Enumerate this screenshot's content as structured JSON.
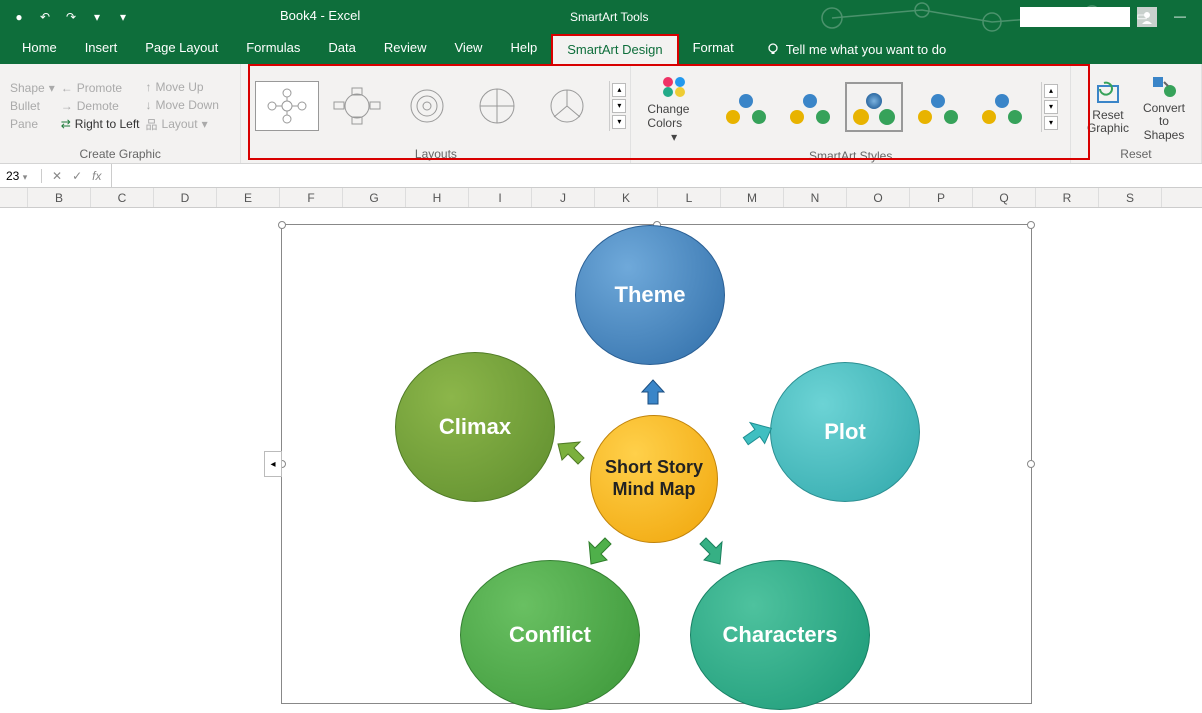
{
  "app": {
    "title": "Book4 - Excel",
    "context_tab": "SmartArt Tools"
  },
  "tabs": {
    "home": "Home",
    "insert": "Insert",
    "page_layout": "Page Layout",
    "formulas": "Formulas",
    "data": "Data",
    "review": "Review",
    "view": "View",
    "help": "Help",
    "smartart_design": "SmartArt Design",
    "format": "Format",
    "tell_me": "Tell me what you want to do"
  },
  "ribbon": {
    "create_graphic": {
      "label": "Create Graphic",
      "shape": "Shape",
      "bullet": "Bullet",
      "pane": "Pane",
      "promote": "Promote",
      "demote": "Demote",
      "rtl": "Right to Left",
      "move_up": "Move Up",
      "move_down": "Move Down",
      "layout": "Layout"
    },
    "layouts": {
      "label": "Layouts"
    },
    "change_colors": "Change Colors",
    "styles": {
      "label": "SmartArt Styles"
    },
    "reset": {
      "reset_graphic": "Reset Graphic",
      "convert": "Convert to Shapes",
      "label": "Reset"
    }
  },
  "formula_bar": {
    "name_box": "23",
    "fx": "fx"
  },
  "columns": [
    "B",
    "C",
    "D",
    "E",
    "F",
    "G",
    "H",
    "I",
    "J",
    "K",
    "L",
    "M",
    "N",
    "O",
    "P",
    "Q",
    "R",
    "S"
  ],
  "smartart": {
    "center": "Short Story Mind Map",
    "nodes": {
      "theme": "Theme",
      "plot": "Plot",
      "characters": "Characters",
      "conflict": "Conflict",
      "climax": "Climax"
    }
  }
}
